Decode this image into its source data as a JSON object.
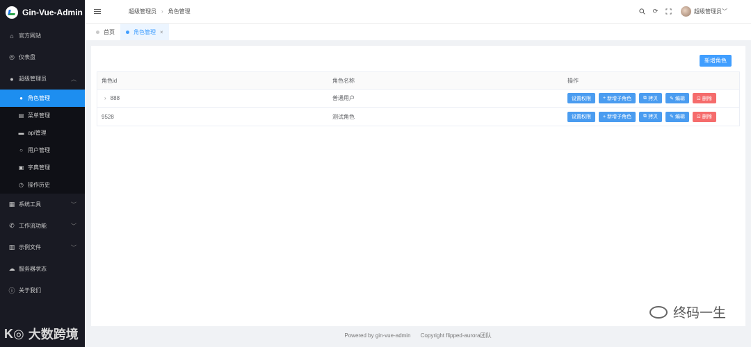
{
  "app": {
    "name": "Gin-Vue-Admin"
  },
  "sidebar": {
    "items": [
      {
        "label": "官方网站",
        "icon": "home-icon"
      },
      {
        "label": "仪表盘",
        "icon": "dashboard-icon"
      },
      {
        "label": "超级管理员",
        "icon": "user-icon",
        "expanded": true,
        "children": [
          {
            "label": "角色管理",
            "icon": "user-icon",
            "active": true
          },
          {
            "label": "菜单管理",
            "icon": "menu-icon"
          },
          {
            "label": "api管理",
            "icon": "platform-icon"
          },
          {
            "label": "用户管理",
            "icon": "user-outline-icon"
          },
          {
            "label": "字典管理",
            "icon": "notebook-icon"
          },
          {
            "label": "操作历史",
            "icon": "clock-icon"
          }
        ]
      },
      {
        "label": "系统工具",
        "icon": "tools-icon"
      },
      {
        "label": "工作流功能",
        "icon": "phone-icon"
      },
      {
        "label": "示例文件",
        "icon": "chart-icon"
      },
      {
        "label": "服务器状态",
        "icon": "cloud-icon"
      },
      {
        "label": "关于我们",
        "icon": "info-icon"
      }
    ]
  },
  "header": {
    "breadcrumb": [
      "超级管理员",
      "角色管理"
    ],
    "user": "超级管理员"
  },
  "tabs": [
    {
      "label": "首页",
      "active": false
    },
    {
      "label": "角色管理",
      "active": true
    }
  ],
  "toolbar": {
    "add_label": "新增角色"
  },
  "table": {
    "headers": [
      "角色id",
      "角色名称",
      "操作"
    ],
    "rows": [
      {
        "id": "888",
        "name": "普通用户",
        "expandable": true
      },
      {
        "id": "9528",
        "name": "测试角色",
        "expandable": false
      }
    ],
    "actions": [
      "设置权限",
      "新增子角色",
      "拷贝",
      "编辑",
      "删除"
    ]
  },
  "footer": {
    "powered": "Powered by gin-vue-admin",
    "copyright": "Copyright flipped-aurora团队"
  },
  "watermarks": {
    "right": "终码一生",
    "left": "大数跨境"
  },
  "colors": {
    "primary": "#409eff",
    "danger": "#f56c6c",
    "sidebar": "#191a23",
    "active_menu": "#1d8ef0"
  }
}
